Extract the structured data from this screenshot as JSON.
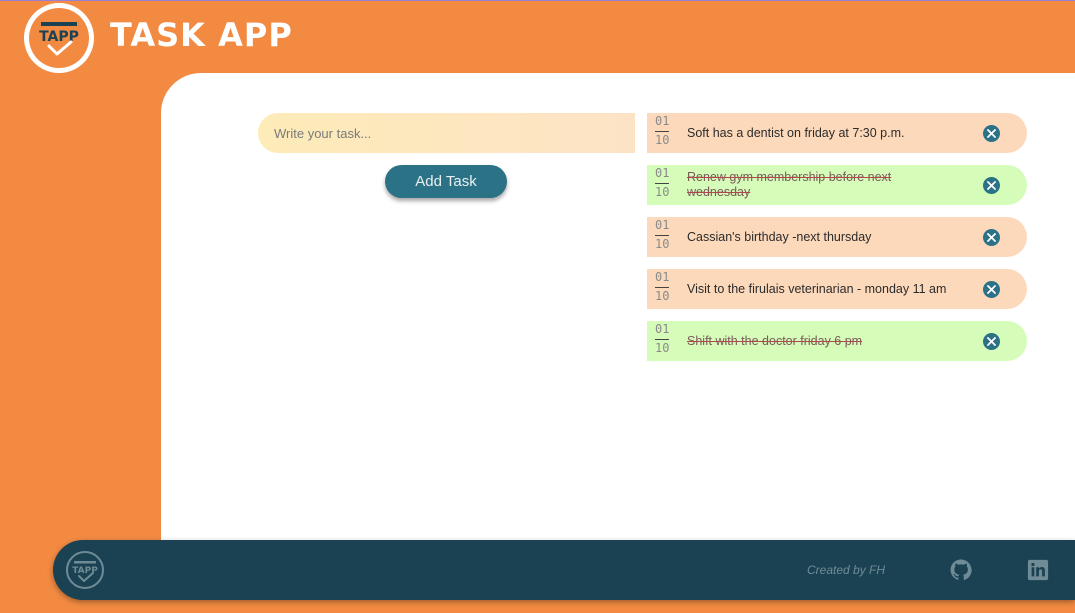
{
  "header": {
    "logo_text": "TAPP",
    "title": "TASK APP"
  },
  "form": {
    "placeholder": "Write your task...",
    "add_label": "Add Task"
  },
  "tasks": [
    {
      "day": "01",
      "month": "10",
      "text": "Soft has a dentist on friday at 7:30 p.m.",
      "done": false
    },
    {
      "day": "01",
      "month": "10",
      "text": "Renew gym membership before next wednesday",
      "done": true
    },
    {
      "day": "01",
      "month": "10",
      "text": "Cassian's birthday -next thursday",
      "done": false
    },
    {
      "day": "01",
      "month": "10",
      "text": "Visit to the firulais veterinarian - monday 11 am",
      "done": false
    },
    {
      "day": "01",
      "month": "10",
      "text": "Shift with the doctor friday 6 pm",
      "done": true
    }
  ],
  "footer": {
    "credit": "Created by FH",
    "icons": [
      "github-icon",
      "linkedin-icon"
    ]
  },
  "colors": {
    "brand_orange": "#f28a42",
    "accent_teal": "#2c7287",
    "footer_navy": "#1b4252",
    "pending_bg": "#fdd9bb",
    "done_bg": "#d5fdb9"
  }
}
